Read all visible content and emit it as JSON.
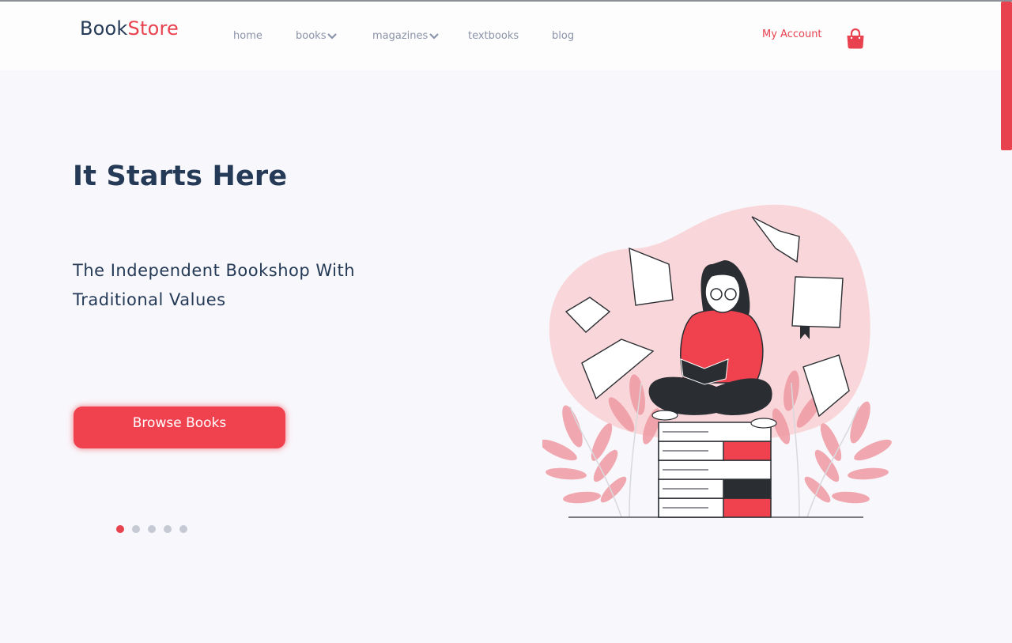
{
  "brand": {
    "part1": "Book",
    "part2": "Store"
  },
  "nav": {
    "items": [
      {
        "label": "home",
        "has_dropdown": false
      },
      {
        "label": "books",
        "has_dropdown": true
      },
      {
        "label": "magazines",
        "has_dropdown": true
      },
      {
        "label": "textbooks",
        "has_dropdown": false
      },
      {
        "label": "blog",
        "has_dropdown": false
      }
    ],
    "account_label": "My Account",
    "cart_icon": "shopping-bag-icon"
  },
  "hero": {
    "title": "It Starts Here",
    "subtitle_line1": "The Independent Bookshop With",
    "subtitle_line2": "Traditional Values",
    "cta_label": "Browse Books",
    "slide_count": 5,
    "active_slide": 1
  },
  "colors": {
    "accent": "#e8424f",
    "heading": "#243a56",
    "nav_text": "#8a93a8",
    "background": "#f8f7fb"
  }
}
